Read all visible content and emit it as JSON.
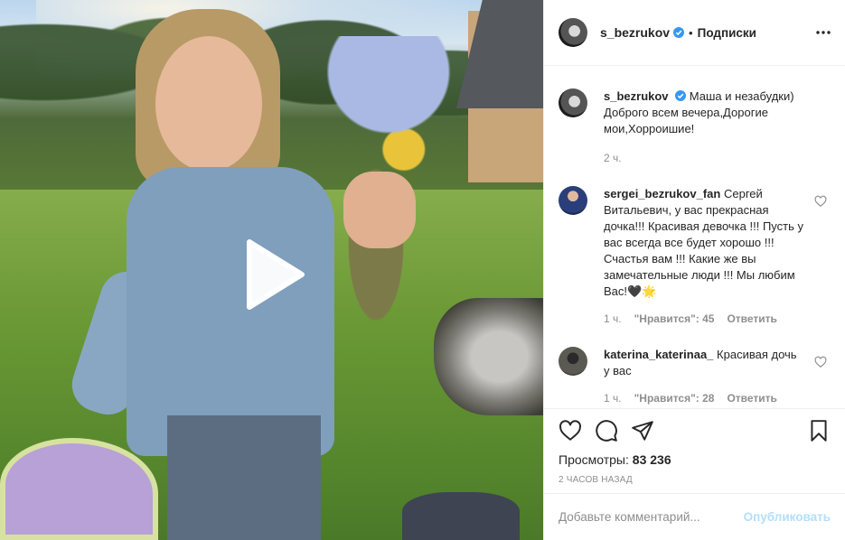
{
  "post": {
    "author": "s_bezrukov",
    "follow_label": "Подписки",
    "dot": "•",
    "verified_color": "#3897f0"
  },
  "caption": {
    "user": "s_bezrukov",
    "text": "Маша и незабудки) Доброго всем вечера,Дорогие мои,Хорроишие!",
    "time": "2 ч."
  },
  "comments": [
    {
      "user": "sergei_bezrukov_fan",
      "text": "Сергей Витальевич, у вас прекрасная дочка!!! Красивая девочка !!! Пусть у вас всегда все будет хорошо !!! Счастья вам !!! Какие же вы замечательные люди !!! Мы любим Вас!🖤🌟",
      "time": "1 ч.",
      "likes": "\"Нравится\": 45",
      "reply": "Ответить"
    },
    {
      "user": "katerina_katerinaa_",
      "text": "Красивая дочь у вас",
      "time": "1 ч.",
      "likes": "\"Нравится\": 28",
      "reply": "Ответить"
    }
  ],
  "stats": {
    "views_label": "Просмотры:",
    "views_value": "83 236",
    "posted": "2 часов назад"
  },
  "composer": {
    "placeholder": "Добавьте комментарий...",
    "publish_label": "Опубликовать"
  },
  "icons": {
    "more": "more-options-icon",
    "like": "heart-icon",
    "comment": "comment-icon",
    "share": "share-icon",
    "save": "bookmark-icon",
    "play": "play-icon"
  }
}
